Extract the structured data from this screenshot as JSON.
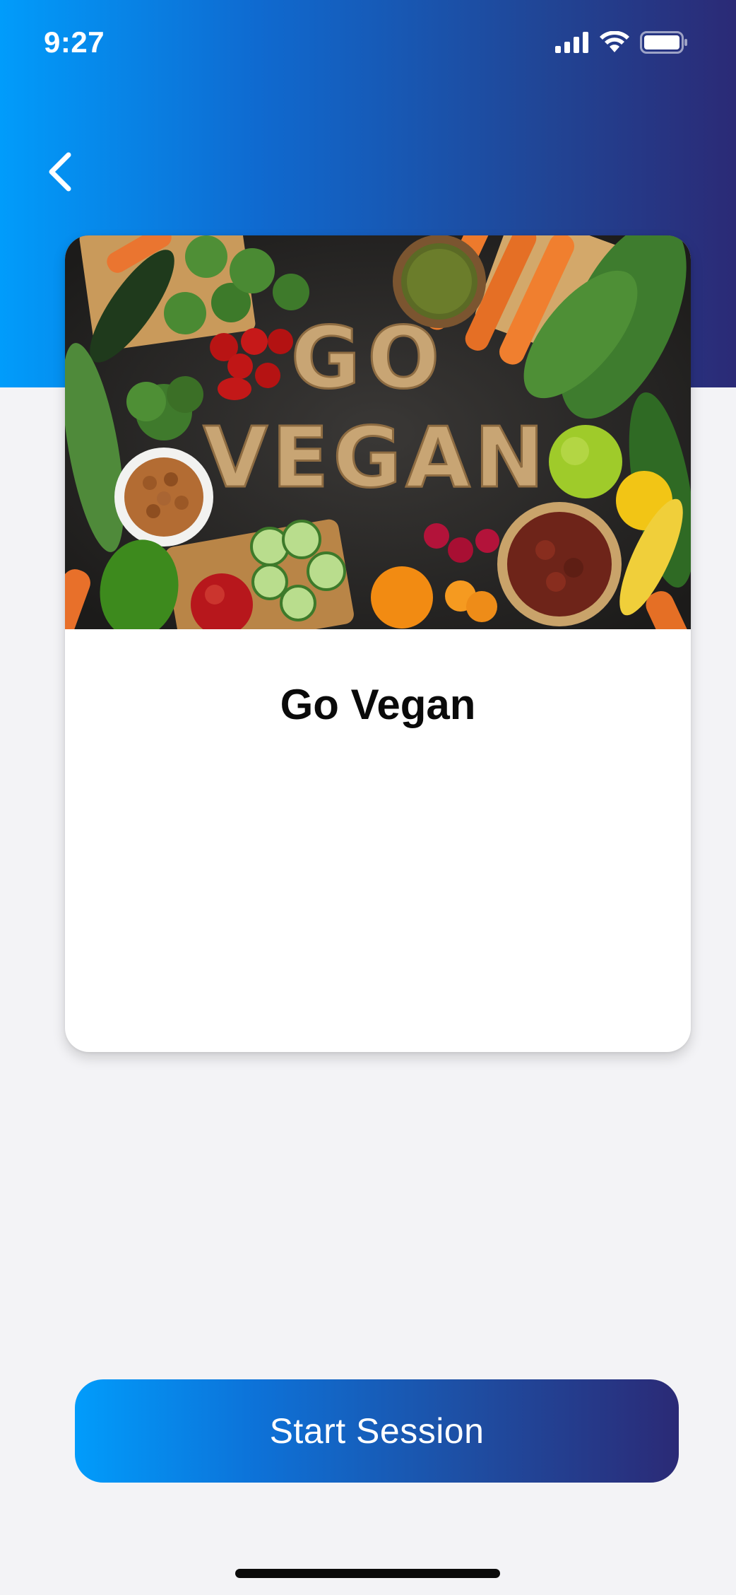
{
  "status_bar": {
    "time": "9:27",
    "icons": [
      "cellular-signal-icon",
      "wifi-icon",
      "battery-icon"
    ]
  },
  "nav": {
    "back_icon": "chevron-left-icon"
  },
  "card": {
    "image_alt": "GO VEGAN",
    "image_text_line1": "GO",
    "image_text_line2": "VEGAN",
    "title": "Go Vegan"
  },
  "actions": {
    "start_session_label": "Start Session"
  },
  "colors": {
    "gradient_start": "#019cfb",
    "gradient_end": "#2b2a76",
    "background": "#f3f3f6",
    "card_background": "#ffffff"
  }
}
